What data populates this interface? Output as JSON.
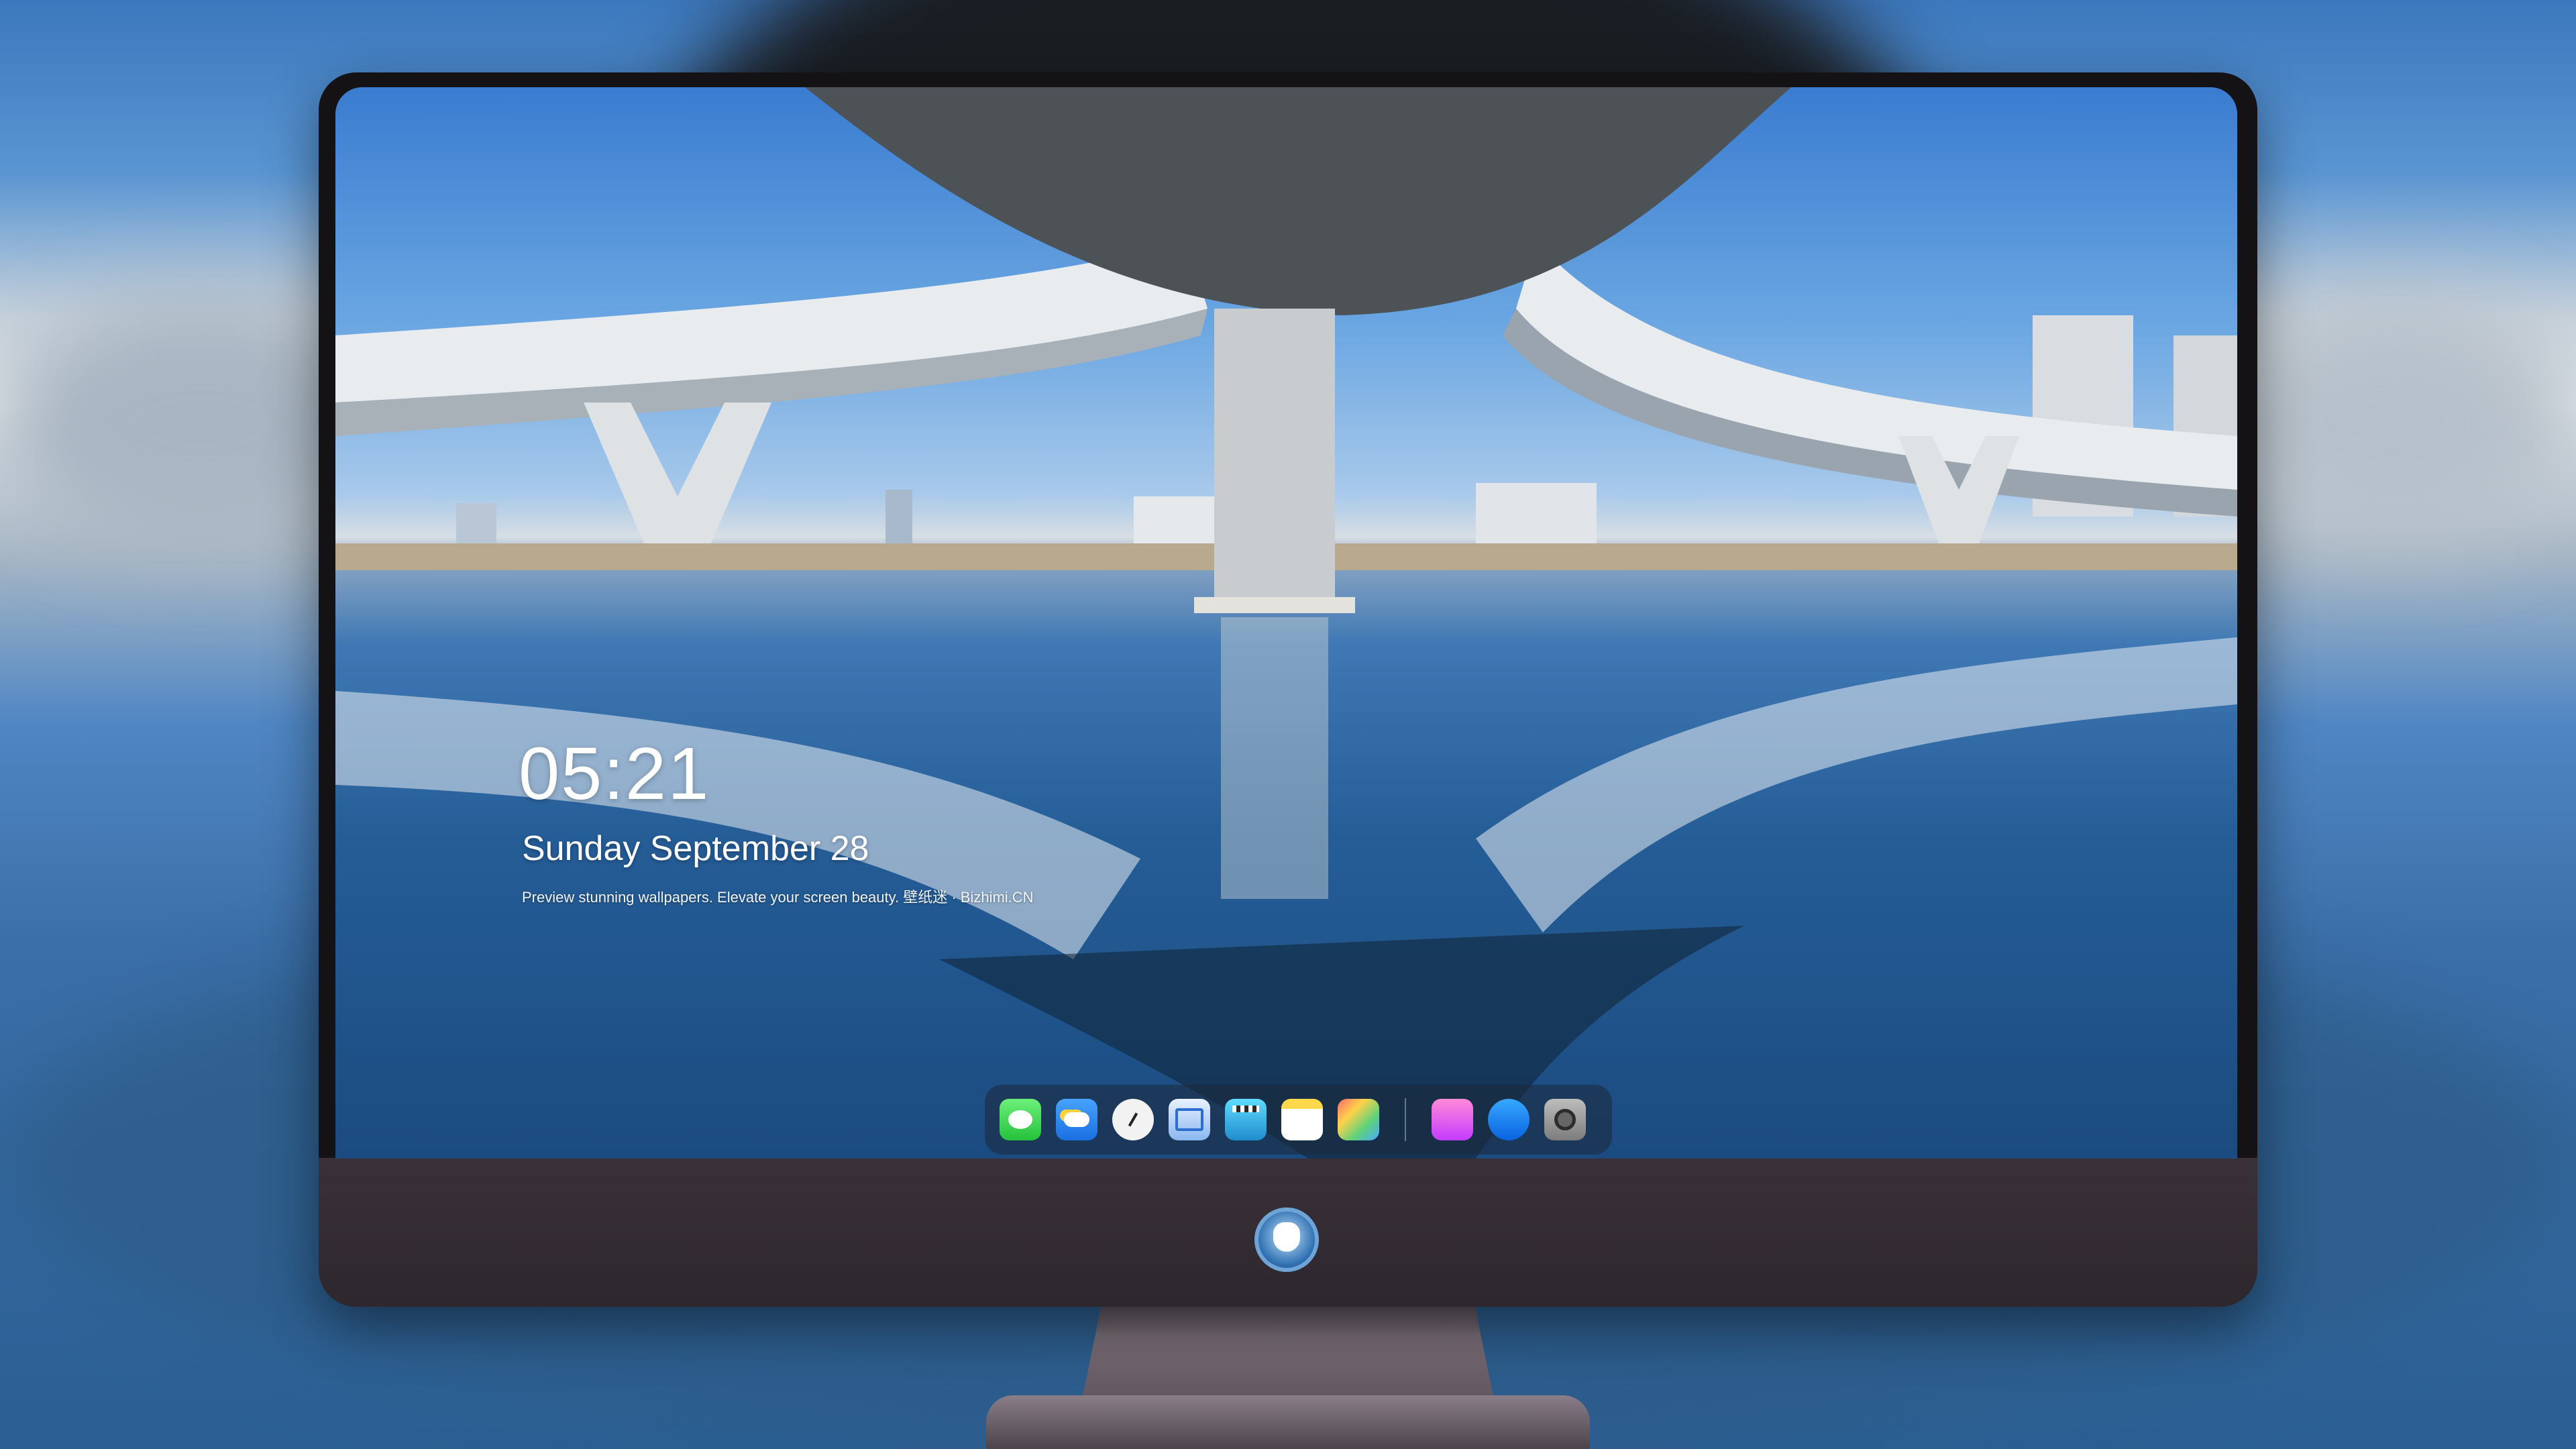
{
  "lockscreen": {
    "time": "05:21",
    "date": "Sunday September  28",
    "tagline": "Preview stunning wallpapers. Elevate your screen beauty. 壁纸迷 · Bizhimi.CN"
  },
  "dock": {
    "apps": [
      {
        "name": "Messages",
        "icon": "messages-icon"
      },
      {
        "name": "Weather",
        "icon": "weather-icon"
      },
      {
        "name": "Clock",
        "icon": "clock-icon"
      },
      {
        "name": "Preview",
        "icon": "preview-icon"
      },
      {
        "name": "Video",
        "icon": "clapperboard-icon"
      },
      {
        "name": "Notes",
        "icon": "notes-icon"
      },
      {
        "name": "Photos",
        "icon": "photos-icon"
      },
      {
        "name": "Music",
        "icon": "music-icon"
      },
      {
        "name": "App Store",
        "icon": "app-store-icon"
      },
      {
        "name": "Camera",
        "icon": "camera-icon"
      }
    ]
  },
  "colors": {
    "sky": "#3a7cd0",
    "water": "#255d97",
    "bezel": "#141214",
    "chin": "#3a3038"
  }
}
